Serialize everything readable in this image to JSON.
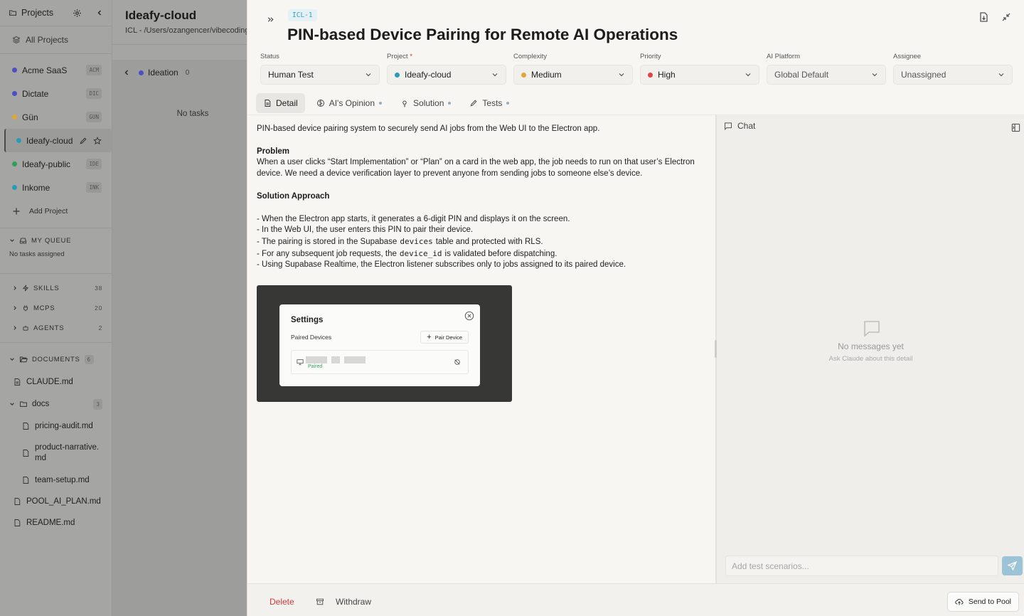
{
  "sidebar": {
    "header": "Projects",
    "all_projects": "All Projects",
    "projects": [
      {
        "name": "Acme SaaS",
        "tag": "ACM",
        "color": "#4a4fc4"
      },
      {
        "name": "Dictate",
        "tag": "DIC",
        "color": "#4a4fc4"
      },
      {
        "name": "Gün",
        "tag": "GUN",
        "color": "#e0a63a"
      },
      {
        "name": "Ideafy-cloud",
        "tag": "",
        "color": "#2a9bb5"
      },
      {
        "name": "Ideafy-public",
        "tag": "IDE",
        "color": "#2e9e5a"
      },
      {
        "name": "Inkome",
        "tag": "INK",
        "color": "#2a9bb5"
      }
    ],
    "add_project": "Add Project",
    "my_queue": "MY QUEUE",
    "no_tasks_assigned": "No tasks assigned",
    "sections": [
      {
        "label": "SKILLS",
        "count": "38"
      },
      {
        "label": "MCPS",
        "count": "20"
      },
      {
        "label": "AGENTS",
        "count": "2"
      }
    ],
    "documents": {
      "label": "DOCUMENTS",
      "count": "6"
    },
    "claude_md": "CLAUDE.md",
    "docs_folder": {
      "label": "docs",
      "count": "3"
    },
    "docs_files": [
      "pricing-audit.md",
      "product-narrative.md",
      "team-setup.md"
    ],
    "pool_plan": "POOL_AI_PLAN.md",
    "readme": "README.md"
  },
  "board": {
    "title": "Ideafy-cloud",
    "path": "ICL - /Users/ozangencer/vibecoding",
    "column": "Ideation",
    "column_count": "0",
    "empty": "No tasks"
  },
  "detail": {
    "id": "ICL-1",
    "title": "PIN-based Device Pairing for Remote AI Operations",
    "fields": {
      "status": {
        "label": "Status",
        "value": "Human Test"
      },
      "project": {
        "label": "Project",
        "required": "*",
        "value": "Ideafy-cloud",
        "dot": "#2a9bb5"
      },
      "complexity": {
        "label": "Complexity",
        "value": "Medium",
        "dot": "#e0a63a"
      },
      "priority": {
        "label": "Priority",
        "value": "High",
        "dot": "#e04545"
      },
      "platform": {
        "label": "AI Platform",
        "value": "Global Default"
      },
      "assignee": {
        "label": "Assignee",
        "value": "Unassigned"
      }
    },
    "tabs": [
      "Detail",
      "AI's Opinion",
      "Solution",
      "Tests"
    ],
    "content": {
      "intro": "PIN-based device pairing system to securely send AI jobs from the Web UI to the Electron app.",
      "problem_heading": "Problem",
      "problem": "When a user clicks “Start Implementation” or “Plan” on a card in the web app, the job needs to run on that user’s Electron device. We need a device verification layer to prevent anyone from sending jobs to someone else’s device.",
      "approach_heading": "Solution Approach",
      "b1": "- When the Electron app starts, it generates a 6-digit PIN and displays it on the screen.",
      "b2": "- In the Web UI, the user enters this PIN to pair their device.",
      "b3a": "- The pairing is stored in the Supabase",
      "b3code": "devices",
      "b3b": "table and protected with RLS.",
      "b4a": "- For any subsequent job requests, the",
      "b4code": "device_id",
      "b4b": "is validated before dispatching.",
      "b5": "- Using Supabase Realtime, the Electron listener subscribes only to jobs assigned to its paired device."
    },
    "embedded": {
      "settings": "Settings",
      "paired_devices": "Paired Devices",
      "pair_device": "Pair Device",
      "paired": "Paired"
    }
  },
  "chat": {
    "label": "Chat",
    "empty_title": "No messages yet",
    "empty_sub": "Ask Claude about this detail",
    "placeholder": "Add test scenarios..."
  },
  "footer": {
    "delete": "Delete",
    "withdraw": "Withdraw",
    "send_to_pool": "Send to Pool"
  }
}
